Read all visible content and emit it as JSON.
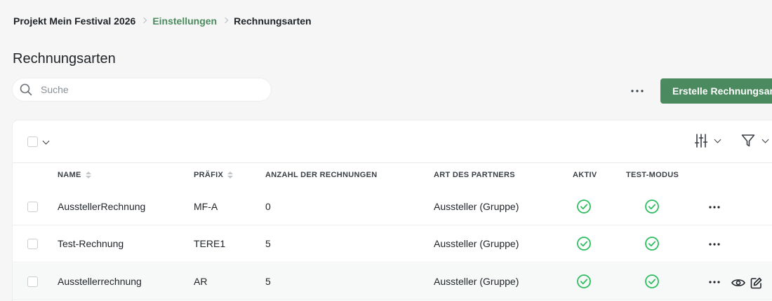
{
  "breadcrumb": {
    "project": "Projekt Mein Festival 2026",
    "settings": "Einstellungen",
    "current": "Rechnungsarten"
  },
  "page": {
    "title": "Rechnungsarten"
  },
  "search": {
    "placeholder": "Suche",
    "value": ""
  },
  "toolbar": {
    "create_label": "Erstelle Rechnungsarten"
  },
  "colors": {
    "accent": "#4a8a5e",
    "check": "#2ebd5f"
  },
  "table": {
    "headers": {
      "name": "NAME",
      "prefix": "PRÄFIX",
      "count": "ANZAHL DER RECHNUNGEN",
      "partner": "ART DES PARTNERS",
      "active": "AKTIV",
      "test": "TEST-MODUS"
    },
    "rows": [
      {
        "name": "AusstellerRechnung",
        "prefix": "MF-A",
        "count": "0",
        "partner": "Aussteller (Gruppe)",
        "active": true,
        "test": true
      },
      {
        "name": "Test-Rechnung",
        "prefix": "TERE1",
        "count": "5",
        "partner": "Aussteller (Gruppe)",
        "active": true,
        "test": true
      },
      {
        "name": "Ausstellerrechnung",
        "prefix": "AR",
        "count": "5",
        "partner": "Aussteller (Gruppe)",
        "active": true,
        "test": true
      }
    ]
  },
  "icons": {
    "search": "search-icon",
    "more": "more-horizontal-icon",
    "columns": "sliders-icon",
    "filter": "filter-icon",
    "check": "check-circle-icon",
    "view": "eye-icon",
    "edit": "edit-icon"
  }
}
